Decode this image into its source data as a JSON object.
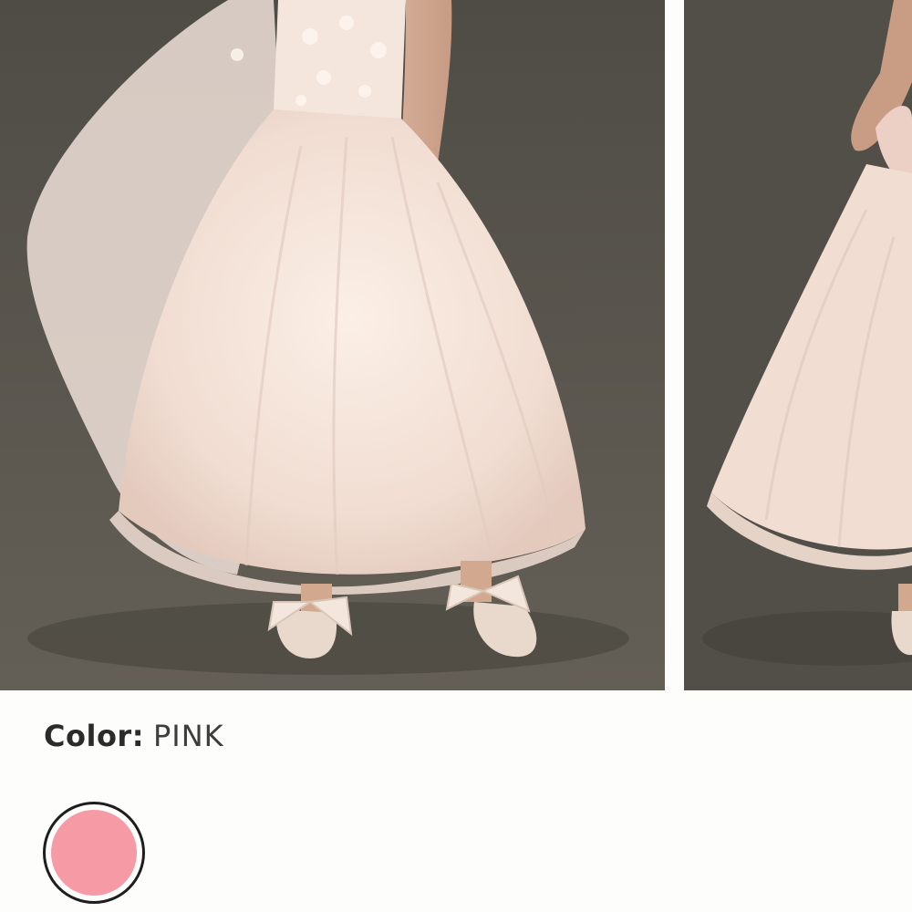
{
  "product_gallery": {
    "images": [
      {
        "name": "main-product-image"
      },
      {
        "name": "secondary-product-image"
      }
    ]
  },
  "color_selector": {
    "label": "Color:",
    "selected_value": "PINK",
    "swatches": [
      {
        "name": "pink",
        "color": "#f69aa5",
        "selected": true
      }
    ]
  },
  "colors": {
    "backdrop": "#514e48",
    "dress": "#f3e2d8",
    "swatch_border": "#1e1e1e"
  }
}
